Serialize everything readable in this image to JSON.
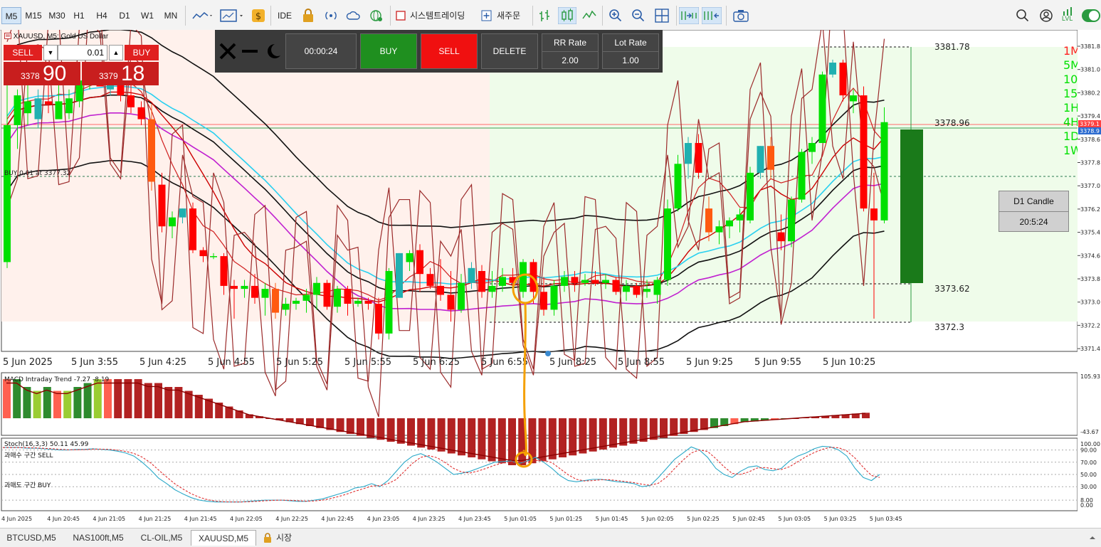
{
  "toolbar": {
    "timeframes": [
      "M5",
      "M15",
      "M30",
      "H1",
      "H4",
      "D1",
      "W1",
      "MN"
    ],
    "active_timeframe": "M5",
    "ide_label": "IDE",
    "trading_label": "시스템트레이딩",
    "new_order_label": "새주문",
    "lvl_label": "LVL"
  },
  "window": {
    "title": "XAUUSD, M5:  Gold US Dollar"
  },
  "trade_panel": {
    "sell_label": "SELL",
    "buy_label": "BUY",
    "lot": "0.01",
    "bid_small": "3378",
    "bid_big": "90",
    "ask_small": "3379",
    "ask_big": "18"
  },
  "control_panel": {
    "timer": "00:00:24",
    "buy_label": "BUY",
    "sell_label": "SELL",
    "delete_label": "DELETE",
    "rr_label": "RR Rate",
    "rr_value": "2.00",
    "lot_rate_label": "Lot Rate",
    "lot_rate_value": "1.00"
  },
  "position_line": {
    "label": "BUY 0.01 at 3377.32"
  },
  "price_levels": [
    "3381.78",
    "3378.96",
    "3373.62",
    "3372.3"
  ],
  "d1_candle": {
    "label": "D1 Candle",
    "timer": "20:5:24"
  },
  "timeframe_list": [
    "1M",
    "5M",
    "10",
    "15",
    "1H",
    "4H",
    "1D",
    "1W"
  ],
  "price_axis": [
    "3381.8",
    "3381.0",
    "3380.2",
    "3379.4",
    "3378.6",
    "3377.8",
    "3377.0",
    "3376.2",
    "3375.4",
    "3374.6",
    "3373.8",
    "3373.0",
    "3372.2",
    "3371.4"
  ],
  "current_price_tags": [
    "3379.1",
    "3378.9"
  ],
  "time_axis_main": [
    "5 Jun 2025",
    "5 Jun 3:55",
    "5 Jun 4:25",
    "5 Jun 4:55",
    "5 Jun 5:25",
    "5 Jun 5:55",
    "5 Jun 6:25",
    "5 Jun 6:55",
    "5 Jun 8:25",
    "5 Jun 8:55",
    "5 Jun 9:25",
    "5 Jun 9:55",
    "5 Jun 10:25"
  ],
  "macd": {
    "label": "MACD Intraday Trend  -7.27 -8.19",
    "axis_top": "105.93",
    "axis_bottom": "-43.67"
  },
  "stoch": {
    "label": "Stoch(16,3,3) 50.11 45.99",
    "sell_zone": "과매수 구간 SELL",
    "buy_zone": "과매도 구간 BUY",
    "axis": [
      "100.00",
      "90.00",
      "70.00",
      "50.00",
      "30.00",
      "8.00",
      "0.00"
    ]
  },
  "time_axis_sub": [
    "4 Jun 2025",
    "4 Jun 20:45",
    "4 Jun 21:05",
    "4 Jun 21:25",
    "4 Jun 21:45",
    "4 Jun 22:05",
    "4 Jun 22:25",
    "4 Jun 22:45",
    "4 Jun 23:05",
    "4 Jun 23:25",
    "4 Jun 23:45",
    "5 Jun 01:05",
    "5 Jun 01:25",
    "5 Jun 01:45",
    "5 Jun 02:05",
    "5 Jun 02:25",
    "5 Jun 02:45",
    "5 Jun 03:05",
    "5 Jun 03:25",
    "5 Jun 03:45"
  ],
  "bottom_tabs": [
    "BTCUSD,M5",
    "NAS100ft,M5",
    "CL-OIL,M5",
    "XAUUSD,M5",
    "시장"
  ],
  "active_tab": "XAUUSD,M5",
  "colors": {
    "bull": "#00e000",
    "bull_teal": "#20b0b0",
    "bear": "#ff0000",
    "bear_orange": "#ff5a10",
    "sell_zone": "#fff1ec",
    "buy_zone": "#effcea",
    "annotation": "#f5a000"
  },
  "candles": [
    [
      3374.2,
      3380.4,
      3374.0,
      3378.8
    ],
    [
      3378.8,
      3380.0,
      3378.0,
      3379.8
    ],
    [
      3379.2,
      3380.6,
      3378.8,
      3379.6
    ],
    [
      3379.0,
      3380.0,
      3378.7,
      3379.7
    ],
    [
      3379.6,
      3380.4,
      3379.2,
      3379.5
    ],
    [
      3379.0,
      3380.2,
      3379.0,
      3379.6
    ],
    [
      3379.2,
      3380.0,
      3379.0,
      3379.7
    ],
    [
      3379.6,
      3380.4,
      3379.4,
      3380.3
    ],
    [
      3380.2,
      3380.6,
      3380.0,
      3380.5
    ],
    [
      3380.4,
      3380.8,
      3380.2,
      3380.1
    ],
    [
      3380.0,
      3380.5,
      3379.8,
      3380.3
    ],
    [
      3380.3,
      3380.5,
      3379.6,
      3379.8
    ],
    [
      3379.8,
      3380.2,
      3379.2,
      3379.4
    ],
    [
      3379.4,
      3379.6,
      3378.8,
      3379.0
    ],
    [
      3379.0,
      3379.5,
      3376.6,
      3376.9
    ],
    [
      3376.8,
      3377.2,
      3375.2,
      3375.4
    ],
    [
      3375.4,
      3375.9,
      3375.0,
      3375.7
    ],
    [
      3375.7,
      3376.0,
      3375.5,
      3376.0
    ],
    [
      3376.0,
      3376.2,
      3374.5,
      3374.6
    ],
    [
      3374.6,
      3374.7,
      3374.2,
      3374.4
    ],
    [
      3374.4,
      3374.5,
      3374.3,
      3374.4
    ],
    [
      3374.4,
      3374.5,
      3373.1,
      3373.4
    ],
    [
      3373.4,
      3373.6,
      3372.3,
      3373.3
    ],
    [
      3373.3,
      3373.6,
      3373.0,
      3373.4
    ],
    [
      3373.4,
      3373.8,
      3372.8,
      3373.0
    ],
    [
      3373.0,
      3373.5,
      3372.4,
      3373.3
    ],
    [
      3373.3,
      3373.5,
      3372.3,
      3372.5
    ],
    [
      3372.6,
      3373.0,
      3372.4,
      3372.8
    ],
    [
      3372.8,
      3373.0,
      3372.6,
      3372.9
    ],
    [
      3372.9,
      3373.3,
      3372.5,
      3373.1
    ],
    [
      3373.1,
      3373.7,
      3372.6,
      3373.5
    ],
    [
      3373.5,
      3373.6,
      3372.6,
      3372.7
    ],
    [
      3372.7,
      3373.4,
      3372.5,
      3373.3
    ],
    [
      3373.3,
      3373.4,
      3372.4,
      3372.8
    ],
    [
      3372.8,
      3373.0,
      3372.7,
      3372.9
    ],
    [
      3372.9,
      3373.0,
      3372.6,
      3372.8
    ],
    [
      3372.8,
      3373.0,
      3371.6,
      3371.8
    ],
    [
      3371.8,
      3374.0,
      3371.6,
      3373.9
    ],
    [
      3373.0,
      3374.5,
      3373.0,
      3374.5
    ],
    [
      3374.2,
      3374.6,
      3373.9,
      3374.5
    ],
    [
      3374.6,
      3374.8,
      3373.2,
      3373.8
    ],
    [
      3373.8,
      3374.0,
      3373.3,
      3373.4
    ],
    [
      3373.4,
      3374.3,
      3372.9,
      3373.1
    ],
    [
      3373.1,
      3373.9,
      3372.2,
      3372.6
    ],
    [
      3372.6,
      3373.8,
      3372.5,
      3373.5
    ],
    [
      3373.5,
      3374.2,
      3373.3,
      3374.0
    ],
    [
      3373.9,
      3374.1,
      3373.0,
      3373.2
    ],
    [
      3373.2,
      3373.9,
      3373.0,
      3373.4
    ],
    [
      3373.4,
      3374.0,
      3373.2,
      3373.7
    ],
    [
      3373.7,
      3374.0,
      3373.4,
      3373.5
    ],
    [
      3373.2,
      3374.3,
      3373.0,
      3374.2
    ],
    [
      3374.2,
      3374.3,
      3372.8,
      3373.2
    ],
    [
      3373.2,
      3373.7,
      3372.4,
      3372.6
    ],
    [
      3372.6,
      3373.6,
      3372.4,
      3373.4
    ],
    [
      3373.4,
      3373.9,
      3373.2,
      3373.7
    ],
    [
      3373.7,
      3373.9,
      3373.2,
      3373.5
    ],
    [
      3373.5,
      3373.8,
      3373.4,
      3373.6
    ],
    [
      3373.6,
      3373.9,
      3373.4,
      3373.5
    ],
    [
      3373.5,
      3373.8,
      3373.3,
      3373.6
    ],
    [
      3373.6,
      3373.7,
      3373.1,
      3373.2
    ],
    [
      3373.2,
      3373.6,
      3372.9,
      3373.4
    ],
    [
      3373.4,
      3373.5,
      3373.0,
      3373.1
    ],
    [
      3373.2,
      3373.6,
      3373.0,
      3373.3
    ],
    [
      3373.1,
      3373.7,
      3372.8,
      3373.6
    ],
    [
      3373.6,
      3376.3,
      3373.4,
      3376.0
    ],
    [
      3376.0,
      3377.8,
      3375.9,
      3377.5
    ],
    [
      3377.5,
      3378.4,
      3377.0,
      3378.2
    ],
    [
      3378.2,
      3378.5,
      3377.0,
      3377.2
    ],
    [
      3376.0,
      3376.4,
      3374.9,
      3375.2
    ],
    [
      3375.2,
      3375.6,
      3374.8,
      3375.4
    ],
    [
      3375.4,
      3375.7,
      3375.0,
      3375.6
    ],
    [
      3375.6,
      3376.0,
      3375.2,
      3375.8
    ],
    [
      3375.6,
      3377.4,
      3375.5,
      3377.2
    ],
    [
      3377.2,
      3378.1,
      3377.0,
      3378.1
    ],
    [
      3378.1,
      3378.4,
      3377.0,
      3377.3
    ],
    [
      3375.2,
      3375.8,
      3374.6,
      3374.9
    ],
    [
      3374.9,
      3376.4,
      3374.7,
      3376.3
    ],
    [
      3376.3,
      3378.0,
      3376.2,
      3377.9
    ],
    [
      3377.9,
      3378.4,
      3377.5,
      3378.2
    ],
    [
      3378.2,
      3380.6,
      3378.2,
      3380.5
    ],
    [
      3380.5,
      3381.0,
      3380.4,
      3380.9
    ],
    [
      3380.9,
      3381.0,
      3379.6,
      3379.8
    ],
    [
      3379.6,
      3380.0,
      3379.2,
      3379.8
    ],
    [
      3379.8,
      3380.1,
      3375.9,
      3376.0
    ],
    [
      3376.0,
      3377.2,
      3372.3,
      3375.6
    ],
    [
      3375.6,
      3379.4,
      3375.5,
      3378.9
    ]
  ],
  "macd_hist": [
    10,
    10,
    8,
    7,
    8,
    7,
    7,
    8,
    9,
    10,
    10,
    10,
    10,
    10,
    9,
    9,
    8,
    8,
    7,
    6,
    5,
    4,
    3,
    2,
    1,
    0.5,
    0,
    -0.5,
    -1,
    -1.5,
    -2,
    -2.5,
    -3,
    -3.5,
    -4,
    -4.5,
    -5,
    -5.5,
    -6,
    -6.5,
    -7,
    -7.5,
    -8,
    -8.5,
    -9,
    -9.5,
    -10,
    -10.5,
    -11,
    -11.5,
    -12,
    -12,
    -11.5,
    -11,
    -10.5,
    -10,
    -9.5,
    -9,
    -8.5,
    -8,
    -7.5,
    -7,
    -6.5,
    -6,
    -5.5,
    -5,
    -4.5,
    -4,
    -3.5,
    -3,
    -2.5,
    -2,
    -1.5,
    -1,
    -0.8,
    -0.6,
    -0.4,
    -0.2,
    0,
    0.2,
    0.4,
    0.6,
    0.8,
    1,
    1.2,
    1.4
  ],
  "stoch_main": [
    94,
    94,
    94,
    93,
    93,
    92,
    91,
    90,
    90,
    91,
    91,
    92,
    91,
    90,
    88,
    85,
    80,
    70,
    58,
    44,
    35,
    25,
    18,
    12,
    8,
    6,
    5,
    5,
    5,
    5,
    6,
    7,
    8,
    8,
    8,
    7,
    6,
    6,
    8,
    10,
    14,
    18,
    22,
    28,
    30,
    35,
    30,
    40,
    55,
    70,
    80,
    84,
    78,
    70,
    60,
    50,
    52,
    55,
    60,
    65,
    70,
    71,
    72,
    68,
    72,
    78,
    70,
    60,
    48,
    40,
    38,
    40,
    42,
    42,
    40,
    38,
    37,
    35,
    30,
    32,
    45,
    60,
    75,
    85,
    95,
    90,
    78,
    60,
    50,
    45,
    55,
    62,
    64,
    58,
    56,
    60,
    72,
    80,
    85,
    92,
    96,
    95,
    90,
    80,
    60,
    45,
    40,
    50
  ]
}
